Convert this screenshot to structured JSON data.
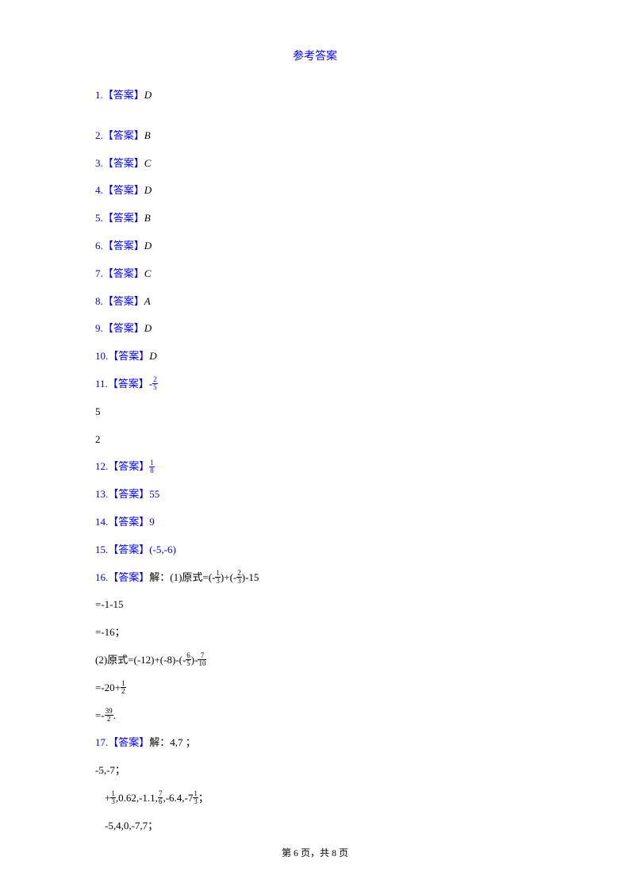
{
  "title": "参考答案",
  "answers": [
    {
      "num": "1.",
      "label": "【答案】",
      "value": "D"
    },
    {
      "num": "2.",
      "label": "【答案】",
      "value": "B"
    },
    {
      "num": "3.",
      "label": "【答案】",
      "value": "C"
    },
    {
      "num": "4.",
      "label": "【答案】",
      "value": "D"
    },
    {
      "num": "5.",
      "label": "【答案】",
      "value": "B"
    },
    {
      "num": "6.",
      "label": "【答案】",
      "value": "D"
    },
    {
      "num": "7.",
      "label": "【答案】",
      "value": "C"
    },
    {
      "num": "8.",
      "label": "【答案】",
      "value": "A"
    },
    {
      "num": "9.",
      "label": "【答案】",
      "value": "D"
    },
    {
      "num": "10.",
      "label": "【答案】",
      "value": "D"
    }
  ],
  "a11": {
    "num": "11.",
    "label": "【答案】",
    "neg": "-",
    "top": "2",
    "bot": "5"
  },
  "stray5": "5",
  "stray2": "2",
  "a12": {
    "num": "12.",
    "label": "【答案】",
    "top": "1",
    "bot": "8"
  },
  "a13": {
    "num": "13.",
    "label": "【答案】",
    "value": "55"
  },
  "a14": {
    "num": "14.",
    "label": "【答案】",
    "value": "9"
  },
  "a15": {
    "num": "15.",
    "label": "【答案】",
    "value": "(-5,-6)"
  },
  "a16": {
    "num": "16.",
    "label": "【答案】",
    "prefix": "解：(1)原式=(-",
    "f1top": "1",
    "f1bot": "3",
    "mid1": ")+(-",
    "f2top": "2",
    "f2bot": "3",
    "suffix1": ")-15",
    "line2": "=-1-15",
    "line3": "=-16；",
    "line4a": "(2)原式=(-12)+(-8)-(-",
    "f3top": "6",
    "f3bot": "5",
    "line4b": ")-",
    "f4top": "7",
    "f4bot": "10",
    "line5a": "=-20+",
    "f5top": "1",
    "f5bot": "2",
    "line6a": "=-",
    "f6top": "39",
    "f6bot": "2",
    "line6b": "."
  },
  "a17": {
    "num": "17.",
    "label": "【答案】",
    "prefix": "解：4,7 ；",
    "line2": "-5,-7；",
    "line3a": "+",
    "f1top": "1",
    "f1bot": "3",
    "line3b": ",0.62,-1.1,",
    "f2top": "7",
    "f2bot": "6",
    "line3c": ",-6.4,-7",
    "f3top": "1",
    "f3bot": "3",
    "line3d": "；",
    "line4": "-5,4,0,-7,7；"
  },
  "footer": {
    "a": "第 ",
    "page": "6",
    "b": " 页，共 ",
    "total": "8",
    "c": " 页"
  }
}
